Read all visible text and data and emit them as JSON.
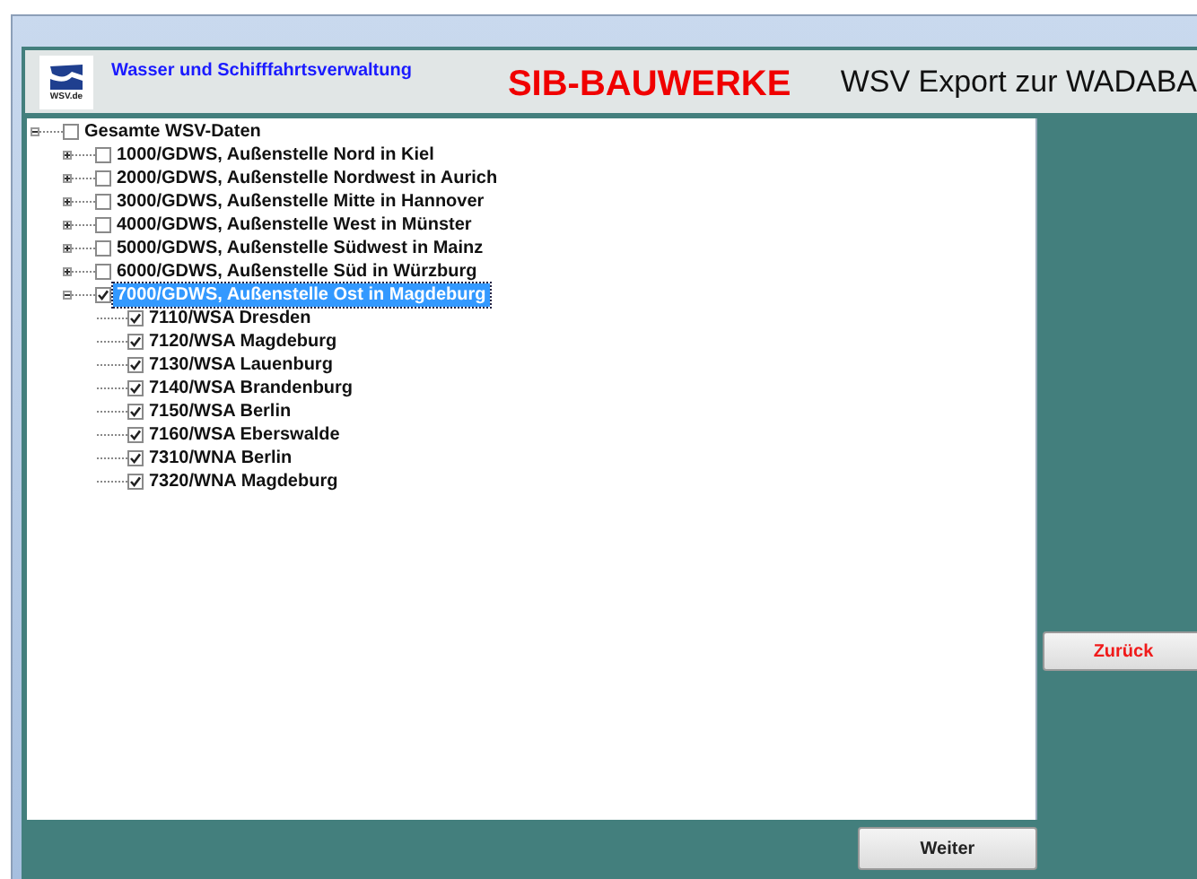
{
  "header": {
    "logo_caption": "WSV.de",
    "agency": "Wasser und Schifffahrtsverwaltung",
    "app_title": "SIB-BAUWERKE",
    "subtitle": "WSV Export zur WADABA"
  },
  "tree": [
    {
      "label": "Gesamte WSV-Daten",
      "checked": false,
      "selected": false,
      "expanded": true,
      "children": [
        {
          "label": "1000/GDWS, Außenstelle Nord in Kiel",
          "checked": false,
          "selected": false,
          "expanded": false
        },
        {
          "label": "2000/GDWS, Außenstelle Nordwest in Aurich",
          "checked": false,
          "selected": false,
          "expanded": false
        },
        {
          "label": "3000/GDWS, Außenstelle Mitte in Hannover",
          "checked": false,
          "selected": false,
          "expanded": false
        },
        {
          "label": "4000/GDWS, Außenstelle West in Münster",
          "checked": false,
          "selected": false,
          "expanded": false
        },
        {
          "label": "5000/GDWS, Außenstelle Südwest in Mainz",
          "checked": false,
          "selected": false,
          "expanded": false
        },
        {
          "label": "6000/GDWS, Außenstelle Süd in Würzburg",
          "checked": false,
          "selected": false,
          "expanded": false
        },
        {
          "label": "7000/GDWS, Außenstelle Ost in Magdeburg",
          "checked": true,
          "selected": true,
          "expanded": true,
          "children": [
            {
              "label": "7110/WSA Dresden",
              "checked": true,
              "selected": false
            },
            {
              "label": "7120/WSA Magdeburg",
              "checked": true,
              "selected": false
            },
            {
              "label": "7130/WSA Lauenburg",
              "checked": true,
              "selected": false
            },
            {
              "label": "7140/WSA Brandenburg",
              "checked": true,
              "selected": false
            },
            {
              "label": "7150/WSA Berlin",
              "checked": true,
              "selected": false
            },
            {
              "label": "7160/WSA Eberswalde",
              "checked": true,
              "selected": false
            },
            {
              "label": "7310/WNA Berlin",
              "checked": true,
              "selected": false
            },
            {
              "label": "7320/WNA Magdeburg",
              "checked": true,
              "selected": false
            }
          ]
        }
      ]
    }
  ],
  "buttons": {
    "back": "Zurück",
    "next": "Weiter"
  }
}
